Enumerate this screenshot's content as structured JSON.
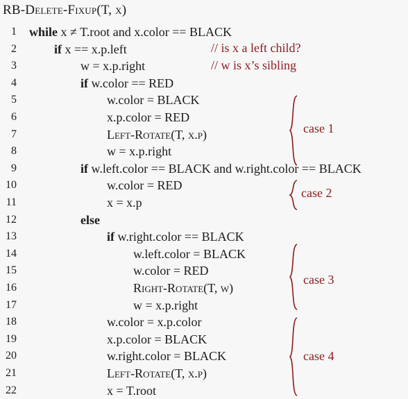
{
  "title": "RB-Delete-Fixup(T, x)",
  "lines": [
    {
      "n": "1",
      "text": "while x ≠ T.root and x.color == BLACK"
    },
    {
      "n": "2",
      "text": "if x == x.p.left"
    },
    {
      "n": "3",
      "text": "w = x.p.right"
    },
    {
      "n": "4",
      "text": "if w.color == RED"
    },
    {
      "n": "5",
      "text": "w.color = BLACK"
    },
    {
      "n": "6",
      "text": "x.p.color = RED"
    },
    {
      "n": "7",
      "text": "Left-Rotate(T, x.p)"
    },
    {
      "n": "8",
      "text": "w = x.p.right"
    },
    {
      "n": "9",
      "text": "if w.left.color == BLACK and w.right.color == BLACK"
    },
    {
      "n": "10",
      "text": "w.color = RED"
    },
    {
      "n": "11",
      "text": "x = x.p"
    },
    {
      "n": "12",
      "text": "else"
    },
    {
      "n": "13",
      "text": "if w.right.color == BLACK"
    },
    {
      "n": "14",
      "text": "w.left.color = BLACK"
    },
    {
      "n": "15",
      "text": "w.color = RED"
    },
    {
      "n": "16",
      "text": "Right-Rotate(T, w)"
    },
    {
      "n": "17",
      "text": "w = x.p.right"
    },
    {
      "n": "18",
      "text": "w.color = x.p.color"
    },
    {
      "n": "19",
      "text": "x.p.color = BLACK"
    },
    {
      "n": "20",
      "text": "w.right.color = BLACK"
    },
    {
      "n": "21",
      "text": "Left-Rotate(T, x.p)"
    },
    {
      "n": "22",
      "text": "x = T.root"
    }
  ],
  "comments": {
    "line2": "// is x a left child?",
    "line3": "// w is x’s sibling"
  },
  "cases": {
    "case1": "case 1",
    "case2": "case 2",
    "case3": "case 3",
    "case4": "case 4"
  },
  "colors": {
    "annotation": "#8b1a1a",
    "text": "#1a1a1a",
    "background": "#f7f7f8"
  }
}
